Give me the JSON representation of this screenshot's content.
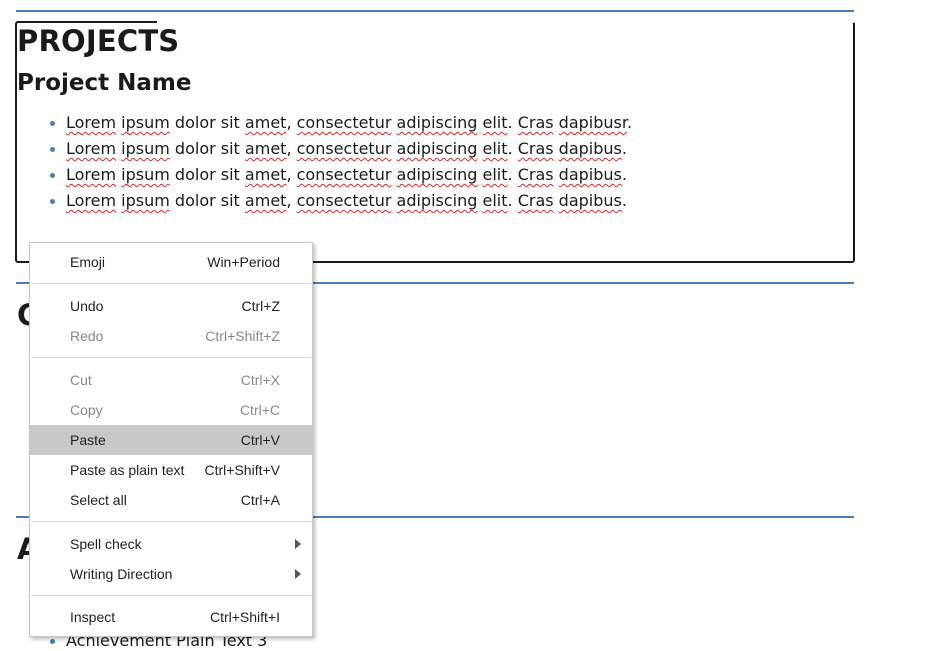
{
  "sections": {
    "projects_title": "PROJECTS",
    "project_name": "Project Name",
    "project_bullets": [
      {
        "w1": "Lorem",
        "w2": "ipsum",
        "mid1": " dolor sit ",
        "w3": "amet",
        "mid2": ", ",
        "w4": "consectetur",
        "mid3": " ",
        "w5": "adipiscing",
        "mid4": " ",
        "w6": "elit",
        "mid5": ". ",
        "w7": "Cras",
        "mid6": " ",
        "w8": "dapibusr",
        "end": "."
      },
      {
        "w1": "Lorem",
        "w2": "ipsum",
        "mid1": " dolor sit ",
        "w3": "amet",
        "mid2": ", ",
        "w4": "consectetur",
        "mid3": " ",
        "w5": "adipiscing",
        "mid4": " ",
        "w6": "elit",
        "mid5": ". ",
        "w7": "Cras",
        "mid6": " ",
        "w8": "dapibus",
        "end": "."
      },
      {
        "w1": "Lorem",
        "w2": "ipsum",
        "mid1": " dolor sit ",
        "w3": "amet",
        "mid2": ", ",
        "w4": "consectetur",
        "mid3": " ",
        "w5": "adipiscing",
        "mid4": " ",
        "w6": "elit",
        "mid5": ". ",
        "w7": "Cras",
        "mid6": " ",
        "w8": "dapibus",
        "end": "."
      },
      {
        "w1": "Lorem",
        "w2": "ipsum",
        "mid1": " dolor sit ",
        "w3": "amet",
        "mid2": ", ",
        "w4": "consectetur",
        "mid3": " ",
        "w5": "adipiscing",
        "mid4": " ",
        "w6": "elit",
        "mid5": ". ",
        "w7": "Cras",
        "mid6": " ",
        "w8": "dapibus",
        "end": "."
      }
    ],
    "partial_title_2": "C",
    "partial_title_3": "A",
    "achievement_bullet": "Achievement Plain Text 3"
  },
  "context_menu": {
    "items": [
      {
        "label": "Emoji",
        "shortcut": "Win+Period"
      },
      {
        "label": "Undo",
        "shortcut": "Ctrl+Z"
      },
      {
        "label": "Redo",
        "shortcut": "Ctrl+Shift+Z"
      },
      {
        "label": "Cut",
        "shortcut": "Ctrl+X"
      },
      {
        "label": "Copy",
        "shortcut": "Ctrl+C"
      },
      {
        "label": "Paste",
        "shortcut": "Ctrl+V"
      },
      {
        "label": "Paste as plain text",
        "shortcut": "Ctrl+Shift+V"
      },
      {
        "label": "Select all",
        "shortcut": "Ctrl+A"
      },
      {
        "label": "Spell check",
        "shortcut": ""
      },
      {
        "label": "Writing Direction",
        "shortcut": ""
      },
      {
        "label": "Inspect",
        "shortcut": "Ctrl+Shift+I"
      }
    ]
  },
  "colors": {
    "accent_rule": "#4a7fb5",
    "spell_underline": "#d92b2b",
    "menu_highlight": "#c8c8c8"
  }
}
